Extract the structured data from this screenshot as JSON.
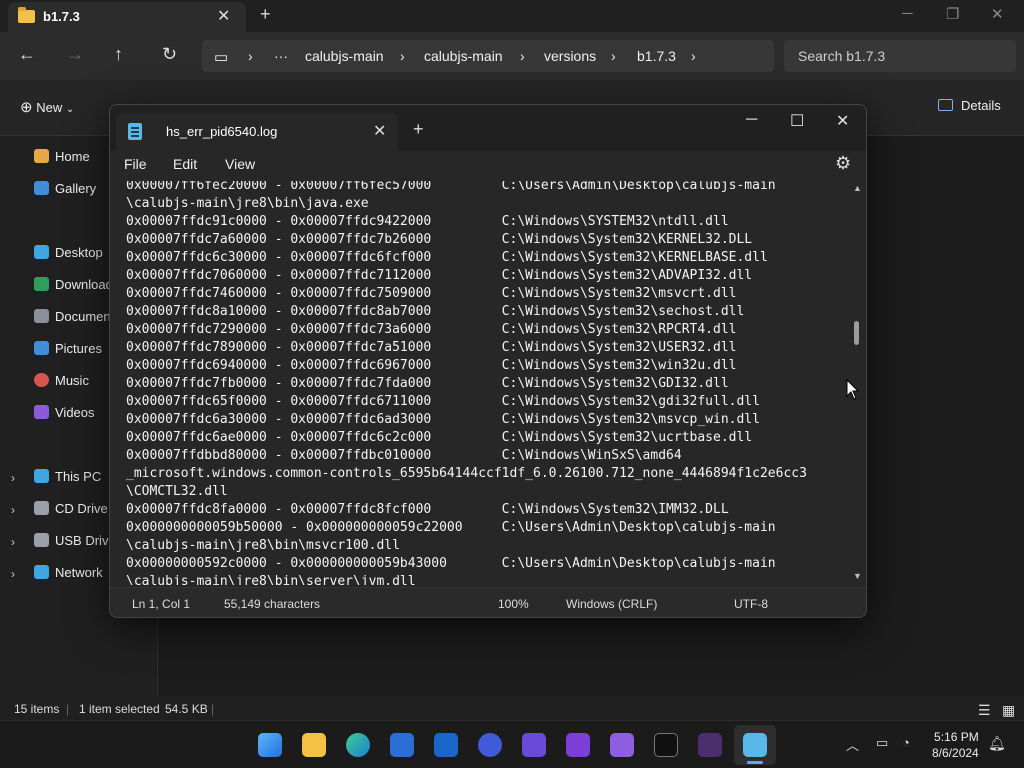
{
  "explorer": {
    "tab_title": "b1.7.3",
    "breadcrumb": [
      "calubjs-main",
      "calubjs-main",
      "versions",
      "b1.7.3"
    ],
    "search_placeholder": "Search b1.7.3",
    "new_label": "New",
    "details_label": "Details",
    "sidebar": {
      "home": "Home",
      "gallery": "Gallery",
      "desktop": "Desktop",
      "downloads": "Download",
      "documents": "Document",
      "pictures": "Pictures",
      "music": "Music",
      "videos": "Videos",
      "this_pc": "This PC",
      "cd_drive": "CD Drive (I",
      "usb_drive": "USB Drive",
      "network": "Network"
    },
    "status": {
      "items": "15 items",
      "selected": "1 item selected",
      "size": "54.5 KB"
    }
  },
  "notepad": {
    "tab_title": "hs_err_pid6540.log",
    "menu": {
      "file": "File",
      "edit": "Edit",
      "view": "View"
    },
    "lines": [
      "0x00007ff6fec20000 - 0x00007ff6fec57000         C:\\Users\\Admin\\Desktop\\calubjs-main",
      "\\calubjs-main\\jre8\\bin\\java.exe",
      "0x00007ffdc91c0000 - 0x00007ffdc9422000         C:\\Windows\\SYSTEM32\\ntdll.dll",
      "0x00007ffdc7a60000 - 0x00007ffdc7b26000         C:\\Windows\\System32\\KERNEL32.DLL",
      "0x00007ffdc6c30000 - 0x00007ffdc6fcf000         C:\\Windows\\System32\\KERNELBASE.dll",
      "0x00007ffdc7060000 - 0x00007ffdc7112000         C:\\Windows\\System32\\ADVAPI32.dll",
      "0x00007ffdc7460000 - 0x00007ffdc7509000         C:\\Windows\\System32\\msvcrt.dll",
      "0x00007ffdc8a10000 - 0x00007ffdc8ab7000         C:\\Windows\\System32\\sechost.dll",
      "0x00007ffdc7290000 - 0x00007ffdc73a6000         C:\\Windows\\System32\\RPCRT4.dll",
      "0x00007ffdc7890000 - 0x00007ffdc7a51000         C:\\Windows\\System32\\USER32.dll",
      "0x00007ffdc6940000 - 0x00007ffdc6967000         C:\\Windows\\System32\\win32u.dll",
      "0x00007ffdc7fb0000 - 0x00007ffdc7fda000         C:\\Windows\\System32\\GDI32.dll",
      "0x00007ffdc65f0000 - 0x00007ffdc6711000         C:\\Windows\\System32\\gdi32full.dll",
      "0x00007ffdc6a30000 - 0x00007ffdc6ad3000         C:\\Windows\\System32\\msvcp_win.dll",
      "0x00007ffdc6ae0000 - 0x00007ffdc6c2c000         C:\\Windows\\System32\\ucrtbase.dll",
      "0x00007ffdbbd80000 - 0x00007ffdbc010000         C:\\Windows\\WinSxS\\amd64",
      "_microsoft.windows.common-controls_6595b64144ccf1df_6.0.26100.712_none_4446894f1c2e6cc3",
      "\\COMCTL32.dll",
      "0x00007ffdc8fa0000 - 0x00007ffdc8fcf000         C:\\Windows\\System32\\IMM32.DLL",
      "0x000000000059b50000 - 0x000000000059c22000     C:\\Users\\Admin\\Desktop\\calubjs-main",
      "\\calubjs-main\\jre8\\bin\\msvcr100.dll",
      "0x00000000592c0000 - 0x000000000059b43000       C:\\Users\\Admin\\Desktop\\calubjs-main",
      "\\calubjs-main\\jre8\\bin\\server\\jvm.dll"
    ],
    "status": {
      "position": "Ln 1, Col 1",
      "characters": "55,149 characters",
      "zoom": "100%",
      "line_ending": "Windows (CRLF)",
      "encoding": "UTF-8"
    }
  },
  "taskbar": {
    "time": "5:16 PM",
    "date": "8/6/2024"
  },
  "colors": {
    "accent": "#5ea9ff",
    "folder": "#f3c244",
    "window_bg": "#272727",
    "desktop_bg": "#202020"
  }
}
